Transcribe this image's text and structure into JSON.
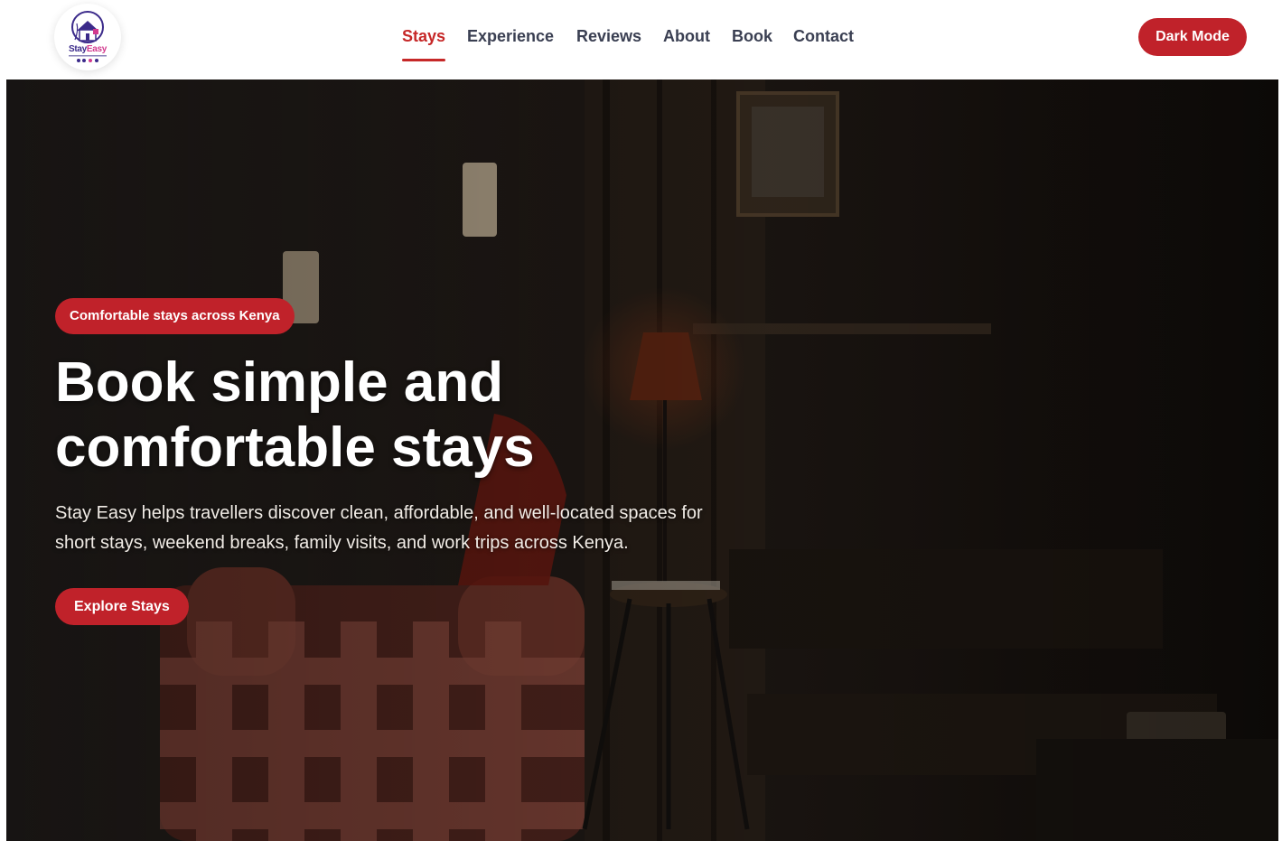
{
  "brand": {
    "logo_word_1": "Stay",
    "logo_word_2": "Easy",
    "colors": {
      "primary": "#3b2a8a",
      "secondary": "#d23a8e"
    }
  },
  "nav": {
    "items": [
      {
        "label": "Stays",
        "active": true
      },
      {
        "label": "Experience",
        "active": false
      },
      {
        "label": "Reviews",
        "active": false
      },
      {
        "label": "About",
        "active": false
      },
      {
        "label": "Book",
        "active": false
      },
      {
        "label": "Contact",
        "active": false
      }
    ]
  },
  "header": {
    "dark_mode_label": "Dark Mode"
  },
  "hero": {
    "badge": "Comfortable stays across Kenya",
    "title_line_1": "Book simple and",
    "title_line_2": "comfortable stays",
    "subtitle": "Stay Easy helps travellers discover clean, affordable, and well-located spaces for short stays, weekend breaks, family visits, and work trips across Kenya.",
    "cta_label": "Explore Stays"
  },
  "colors": {
    "accent": "#c0222a",
    "nav_text": "#3a3f52",
    "nav_active": "#c62828"
  }
}
